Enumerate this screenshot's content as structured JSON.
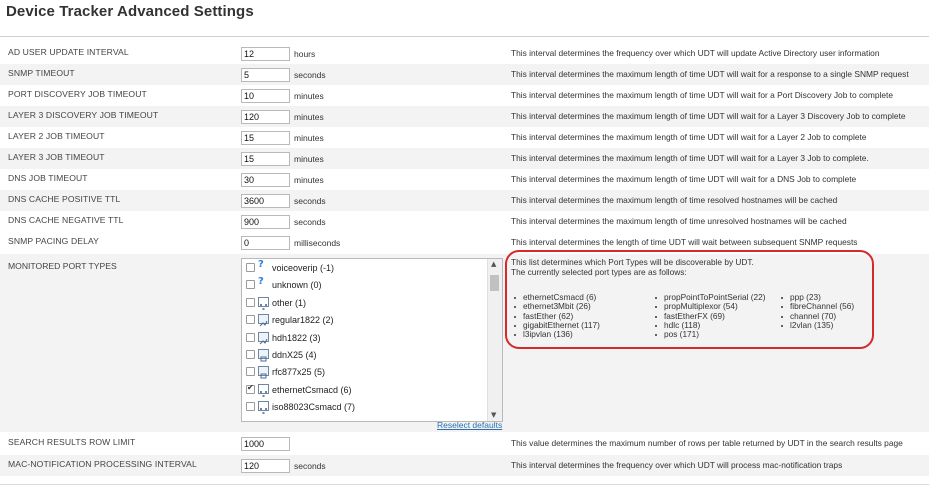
{
  "title": "Device Tracker Advanced Settings",
  "settings": [
    {
      "label": "AD USER UPDATE INTERVAL",
      "value": "12",
      "unit": "hours",
      "desc": "This interval determines the frequency over which UDT will update Active Directory user information"
    },
    {
      "label": "SNMP TIMEOUT",
      "value": "5",
      "unit": "seconds",
      "desc": "This interval determines the maximum length of time UDT will wait for a response to a single SNMP request"
    },
    {
      "label": "PORT DISCOVERY JOB TIMEOUT",
      "value": "10",
      "unit": "minutes",
      "desc": "This interval determines the maximum length of time UDT will wait for a Port Discovery Job to complete"
    },
    {
      "label": "LAYER 3 DISCOVERY JOB TIMEOUT",
      "value": "120",
      "unit": "minutes",
      "desc": "This interval determines the maximum length of time UDT will wait for a Layer 3 Discovery Job to complete"
    },
    {
      "label": "LAYER 2 JOB TIMEOUT",
      "value": "15",
      "unit": "minutes",
      "desc": "This interval determines the maximum length of time UDT will wait for a Layer 2 Job to complete"
    },
    {
      "label": "LAYER 3 JOB TIMEOUT",
      "value": "15",
      "unit": "minutes",
      "desc": "This interval determines the maximum length of time UDT will wait for a Layer 3 Job to complete."
    },
    {
      "label": "DNS JOB TIMEOUT",
      "value": "30",
      "unit": "minutes",
      "desc": "This interval determines the maximum length of time UDT will wait for a DNS Job to complete"
    },
    {
      "label": "DNS CACHE POSITIVE TTL",
      "value": "3600",
      "unit": "seconds",
      "desc": "This interval determines the maximum length of time resolved hostnames will be cached"
    },
    {
      "label": "DNS CACHE NEGATIVE TTL",
      "value": "900",
      "unit": "seconds",
      "desc": "This interval determines the maximum length of time unresolved hostnames will be cached"
    },
    {
      "label": "SNMP PACING DELAY",
      "value": "0",
      "unit": "milliseconds",
      "desc": "This interval determines the length of time UDT will wait between subsequent SNMP requests"
    }
  ],
  "monitored": {
    "label": "MONITORED PORT TYPES",
    "list": [
      {
        "text": "voiceoverip (-1)",
        "checked": false,
        "icon": "question-icon"
      },
      {
        "text": "unknown (0)",
        "checked": false,
        "icon": "question-icon"
      },
      {
        "text": "other (1)",
        "checked": false,
        "icon": "network-icon"
      },
      {
        "text": "regular1822 (2)",
        "checked": false,
        "icon": "port-icon"
      },
      {
        "text": "hdh1822 (3)",
        "checked": false,
        "icon": "port-icon"
      },
      {
        "text": "ddnX25 (4)",
        "checked": false,
        "icon": "port-icon"
      },
      {
        "text": "rfc877x25 (5)",
        "checked": false,
        "icon": "port-icon"
      },
      {
        "text": "ethernetCsmacd (6)",
        "checked": true,
        "icon": "network-icon"
      },
      {
        "text": "iso88023Csmacd (7)",
        "checked": false,
        "icon": "network-icon"
      }
    ],
    "reselect": "Reselect defaults",
    "info_line1": "This list determines which Port Types will be discoverable by UDT.",
    "info_line2": "The currently selected port types are as follows:",
    "selected_col1": [
      "ethernetCsmacd (6)",
      "ethernet3Mbit (26)",
      "fastEther (62)",
      "gigabitEthernet (117)",
      "l3ipvlan (136)"
    ],
    "selected_col2": [
      "propPointToPointSerial (22)",
      "propMultiplexor (54)",
      "fastEtherFX (69)",
      "hdlc (118)",
      "pos (171)"
    ],
    "selected_col3": [
      "ppp (23)",
      "fibreChannel (56)",
      "channel (70)",
      "l2vlan (135)"
    ]
  },
  "bottom_settings": [
    {
      "label": "SEARCH RESULTS ROW LIMIT",
      "value": "1000",
      "unit": "",
      "desc": "This value determines the maximum number of rows per table returned by UDT in the search results page"
    },
    {
      "label": "MAC-NOTIFICATION PROCESSING INTERVAL",
      "value": "120",
      "unit": "seconds",
      "desc": "This interval determines the frequency over which UDT will process mac-notification traps"
    }
  ],
  "colors": {
    "annotation": "#d62a2a",
    "link": "#2a6fb0",
    "row_alt": "#f3f3f3"
  }
}
